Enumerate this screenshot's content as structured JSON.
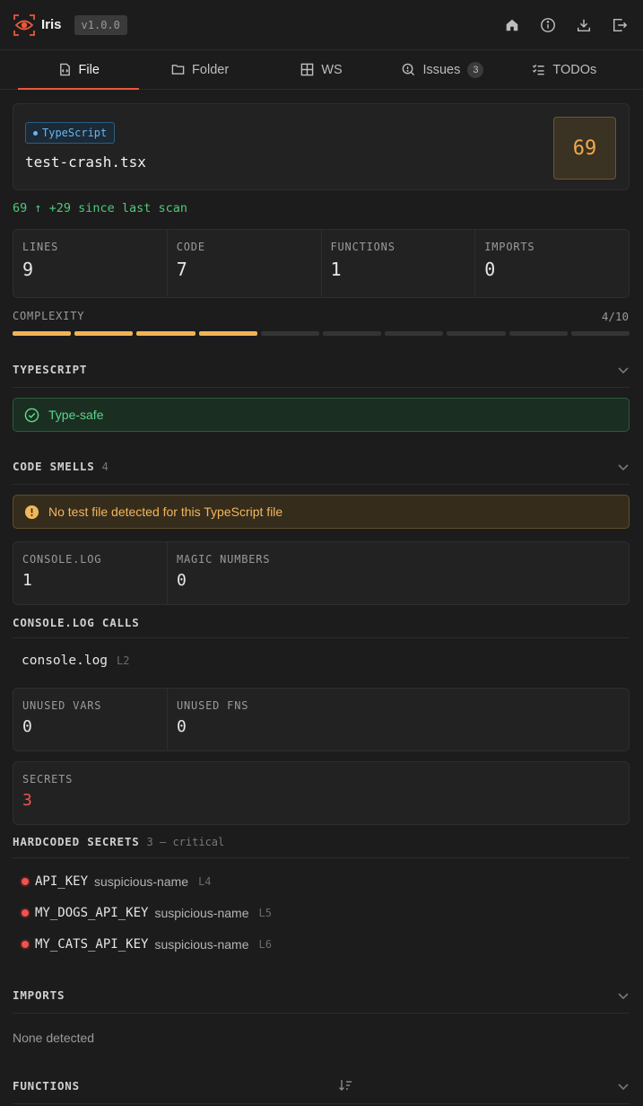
{
  "header": {
    "app_name": "Iris",
    "version": "v1.0.0",
    "actions": [
      "home-icon",
      "info-icon",
      "download-icon",
      "logout-icon"
    ]
  },
  "tabs": [
    {
      "label": "File",
      "icon": "file-code-icon",
      "active": true
    },
    {
      "label": "Folder",
      "icon": "folder-icon"
    },
    {
      "label": "WS",
      "icon": "grid-icon"
    },
    {
      "label": "Issues",
      "icon": "search-issues-icon",
      "badge": "3"
    },
    {
      "label": "TODOs",
      "icon": "checklist-icon"
    }
  ],
  "file": {
    "language": "TypeScript",
    "name": "test-crash.tsx",
    "score": "69",
    "delta": "69 ↑ +29 since last scan"
  },
  "stats": [
    {
      "label": "LINES",
      "value": "9"
    },
    {
      "label": "CODE",
      "value": "7"
    },
    {
      "label": "FUNCTIONS",
      "value": "1"
    },
    {
      "label": "IMPORTS",
      "value": "0"
    }
  ],
  "complexity": {
    "label": "COMPLEXITY",
    "value": "4/10",
    "level": 4,
    "max": 10
  },
  "typescript": {
    "title": "TYPESCRIPT",
    "status": "Type-safe"
  },
  "code_smells": {
    "title": "CODE SMELLS",
    "count": "4",
    "warning": "No test file detected for this TypeScript file",
    "stats": [
      {
        "label": "CONSOLE.LOG",
        "value": "1"
      },
      {
        "label": "MAGIC NUMBERS",
        "value": "0"
      }
    ],
    "console_title": "CONSOLE.LOG CALLS",
    "console_calls": [
      {
        "name": "console.log",
        "line": "L2"
      }
    ],
    "unused": [
      {
        "label": "UNUSED VARS",
        "value": "0"
      },
      {
        "label": "UNUSED FNS",
        "value": "0"
      }
    ],
    "secrets": {
      "label": "SECRETS",
      "value": "3"
    }
  },
  "hardcoded_secrets": {
    "title": "HARDCODED SECRETS",
    "summary": "3 — critical",
    "items": [
      {
        "name": "API_KEY",
        "type": "suspicious-name",
        "line": "L4"
      },
      {
        "name": "MY_DOGS_API_KEY",
        "type": "suspicious-name",
        "line": "L5"
      },
      {
        "name": "MY_CATS_API_KEY",
        "type": "suspicious-name",
        "line": "L6"
      }
    ]
  },
  "imports": {
    "title": "IMPORTS",
    "empty": "None detected"
  },
  "functions": {
    "title": "FUNCTIONS"
  },
  "colors": {
    "accent": "#e8593a",
    "score": "#f0a94a",
    "ok": "#5fd38a",
    "warn": "#f2b75a",
    "danger": "#ef5350",
    "info": "#6ab4ec"
  }
}
